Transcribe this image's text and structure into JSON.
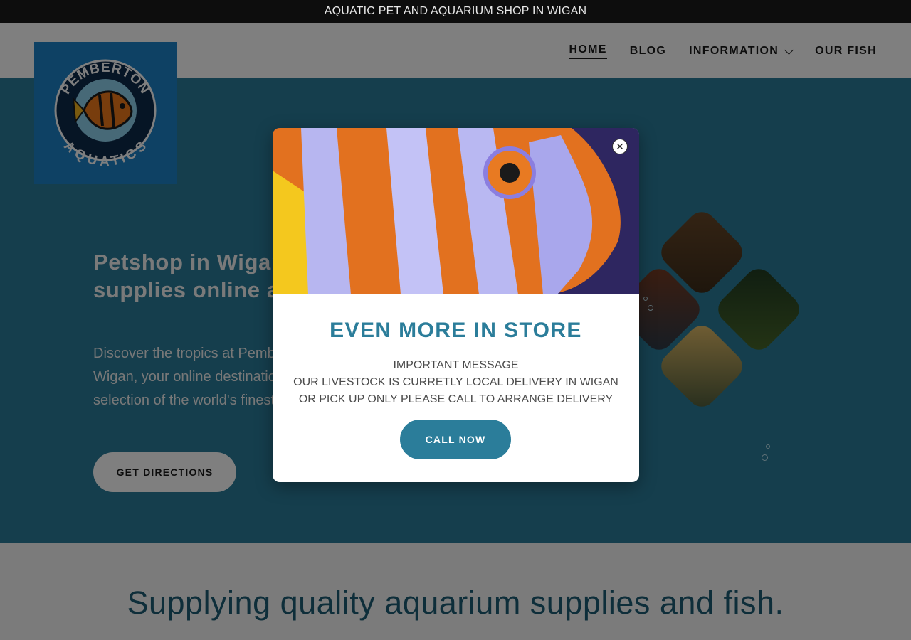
{
  "announcement": "AQUATIC PET AND AQUARIUM SHOP IN WIGAN",
  "logo": {
    "line1": "PEMBERTON",
    "line2": "AQUATICS",
    "icon": "fish-icon"
  },
  "nav": {
    "home": "HOME",
    "blog": "BLOG",
    "information": "INFORMATION",
    "our_fish": "OUR FISH"
  },
  "hero": {
    "title": "Petshop in Wigan aquarium supplies online aquarium",
    "text": "Discover the tropics at Pemberton Aquatics Wigan, your online destination for a vibrant selection of the world's finest tropical fish",
    "directions_button": "GET DIRECTIONS"
  },
  "section2": {
    "title": "Supplying quality aquarium supplies and fish."
  },
  "modal": {
    "close_icon": "close-icon",
    "title": "EVEN MORE IN STORE",
    "message_line1": "IMPORTANT MESSAGE",
    "message_line2": "OUR LIVESTOCK IS CURRETLY LOCAL DELIVERY IN WIGAN OR PICK UP ONLY PLEASE CALL TO ARRANGE DELIVERY",
    "call_button": "CALL NOW"
  },
  "colors": {
    "accent": "#2b7d9a",
    "announce_bg": "#0d0d0d",
    "logo_bg": "#1d83c9",
    "section_title": "#1c5d74"
  }
}
